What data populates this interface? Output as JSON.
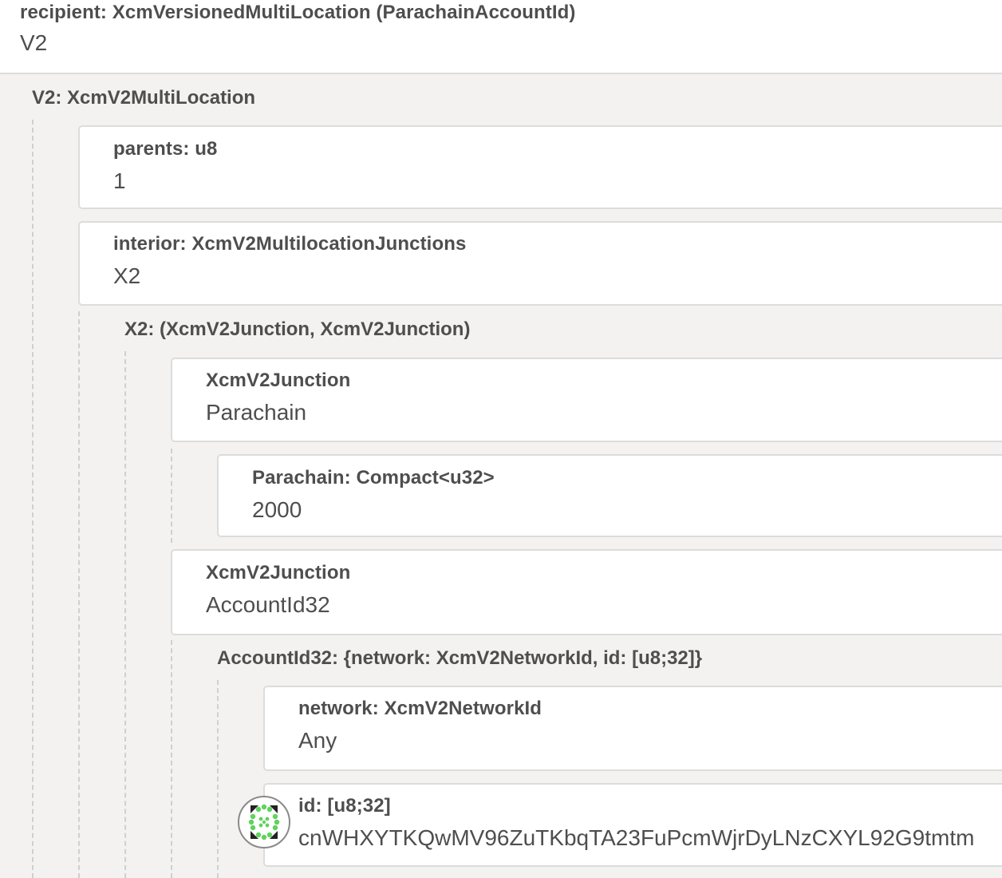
{
  "recipient": {
    "label": "recipient: XcmVersionedMultiLocation (ParachainAccountId)",
    "value": "V2"
  },
  "v2": {
    "label": "V2: XcmV2MultiLocation"
  },
  "parents": {
    "label": "parents: u8",
    "value": "1"
  },
  "interior": {
    "label": "interior: XcmV2MultilocationJunctions",
    "value": "X2"
  },
  "x2": {
    "label": "X2: (XcmV2Junction, XcmV2Junction)"
  },
  "junction1": {
    "label": "XcmV2Junction",
    "value": "Parachain"
  },
  "parachain": {
    "label": "Parachain: Compact<u32>",
    "value": "2000"
  },
  "junction2": {
    "label": "XcmV2Junction",
    "value": "AccountId32"
  },
  "accountid32": {
    "label": "AccountId32: {network: XcmV2NetworkId, id: [u8;32]}"
  },
  "network": {
    "label": "network: XcmV2NetworkId",
    "value": "Any"
  },
  "id": {
    "label": "id: [u8;32]",
    "value": "cnWHXYTKQwMV96ZuTKbqTA23FuPcmWjrDyLNzCXYL92G9tmtm"
  },
  "colors": {
    "background": "#f3f2f1",
    "card": "#ffffff",
    "text": "#4e4e4e",
    "identicon_dot": "#5fd35f"
  }
}
